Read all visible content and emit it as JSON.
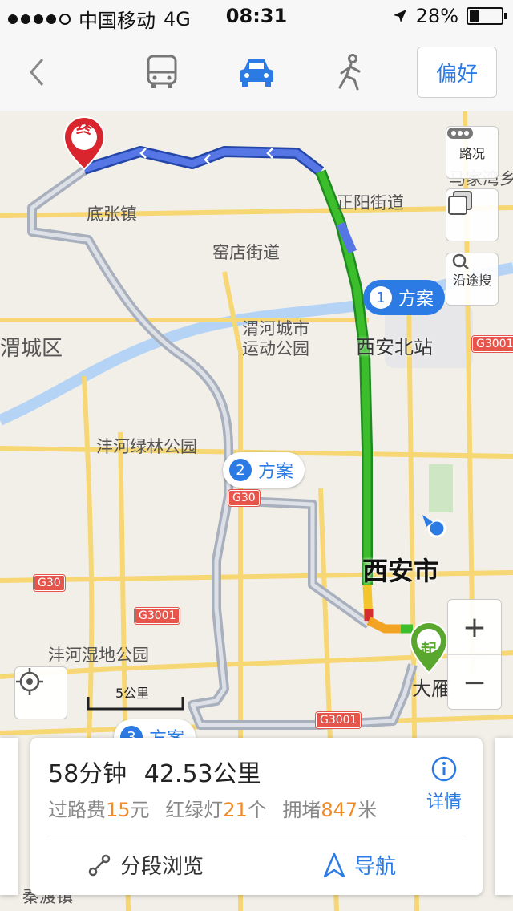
{
  "status_bar": {
    "carrier": "中国移动",
    "network": "4G",
    "time": "08:31",
    "battery": "28%",
    "battery_level": 0.28,
    "signal_bars": 4
  },
  "nav": {
    "modes": [
      "bus-icon",
      "car-icon",
      "walk-icon"
    ],
    "selected_mode": "car-icon",
    "preference_label": "偏好",
    "accent_color": "#2c7be5"
  },
  "map": {
    "places": {
      "di_zhang": "底张镇",
      "zheng_yang": "正阳街道",
      "yao_dian": "窑店街道",
      "wei_he_park_1": "渭河城市",
      "wei_he_park_2": "运动公园",
      "wei_cheng": "渭城区",
      "xian_north": "西安北站",
      "feng_he_green": "沣河绿林公园",
      "xian_city": "西安市",
      "feng_he_wetland": "沣河湿地公园",
      "da_yan": "大雁",
      "ma_jia_wan": "马家湾乡",
      "bottom_town": "秦渡镇"
    },
    "highways": {
      "g3001_a": "G3001",
      "g30_a": "G30",
      "g30_b": "G30",
      "g3001_b": "G3001",
      "g3001_c": "G3001"
    },
    "scale_label": "5公里",
    "end_marker": "终",
    "start_marker": "起",
    "plans": [
      {
        "num": "1",
        "label": "方案",
        "active": true
      },
      {
        "num": "2",
        "label": "方案",
        "active": false
      },
      {
        "num": "3",
        "label": "方案",
        "active": false
      }
    ],
    "traffic_label": "路况",
    "along_search_label": "沿途搜"
  },
  "route_card": {
    "duration": "58分钟",
    "distance": "42.53公里",
    "toll_label": "过路费",
    "toll_value": "15",
    "toll_unit": "元",
    "lights_label": "红绿灯",
    "lights_value": "21",
    "lights_unit": "个",
    "jam_label": "拥堵",
    "jam_value": "847",
    "jam_unit": "米",
    "details_label": "详情",
    "overview_label": "分段浏览",
    "navigate_label": "导航"
  }
}
